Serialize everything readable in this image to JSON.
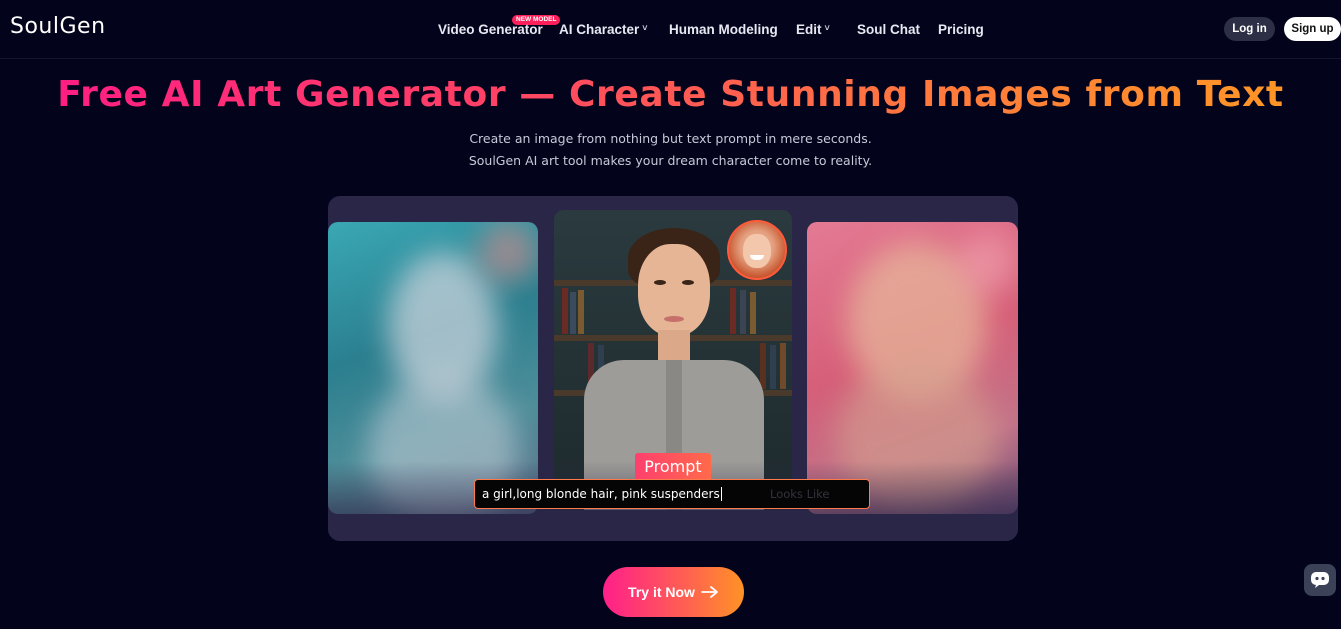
{
  "brand": {
    "logo_text": "SoulGen"
  },
  "nav": {
    "items": [
      {
        "label": "Video Generator",
        "badge": "NEW MODEL",
        "has_dropdown": false
      },
      {
        "label": "AI Character",
        "has_dropdown": true
      },
      {
        "label": "Human Modeling",
        "has_dropdown": false
      },
      {
        "label": "Edit",
        "has_dropdown": true
      },
      {
        "label": "Soul Chat",
        "has_dropdown": false
      },
      {
        "label": "Pricing",
        "has_dropdown": false
      }
    ],
    "caret_glyph": "˅",
    "login_label": "Log in",
    "signup_label": "Sign up"
  },
  "hero": {
    "title": "Free AI Art Generator — Create Stunning Images from Text",
    "subtitle_line1": "Create an image from nothing but text prompt in mere seconds.",
    "subtitle_line2": "SoulGen AI art tool makes your dream character come to reality."
  },
  "prompt": {
    "tag_label": "Prompt",
    "value": "a girl,long blonde hair, pink suspenders",
    "ghost_text": "Looks Like"
  },
  "cta": {
    "label": "Try it Now"
  },
  "icons": {
    "cta_arrow": "arrow-right-icon",
    "chat": "chat-bubble-icon"
  },
  "colors": {
    "background": "#03031c",
    "title_gradient_start": "#ff1a86",
    "title_gradient_end": "#ff9a22",
    "showcase_panel": "#2a2647",
    "new_badge": "#ff1f5a"
  }
}
